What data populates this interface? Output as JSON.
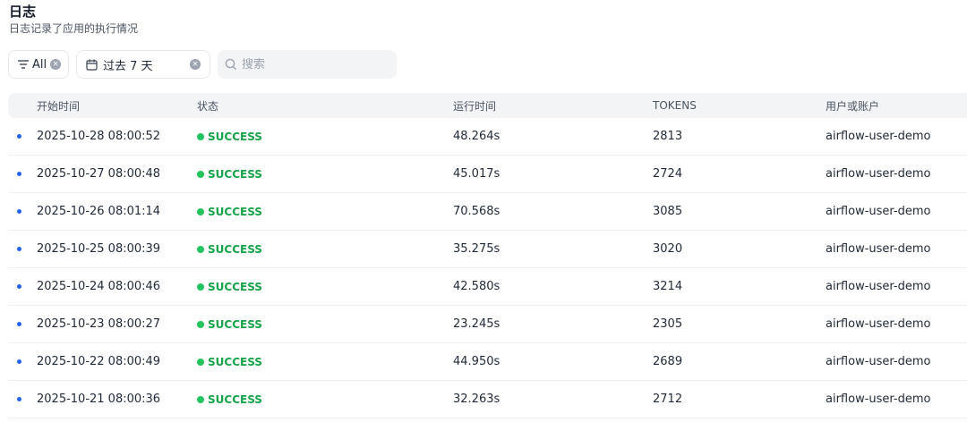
{
  "header": {
    "title": "日志",
    "subtitle": "日志记录了应用的执行情况"
  },
  "filters": {
    "status_label": "All",
    "date_label": "过去 7 天",
    "search_placeholder": "搜索"
  },
  "table": {
    "columns": [
      "开始时间",
      "状态",
      "运行时间",
      "TOKENS",
      "用户或账户"
    ],
    "rows": [
      {
        "start": "2025-10-28 08:00:52",
        "status": "SUCCESS",
        "duration": "48.264s",
        "tokens": "2813",
        "user": "airflow-user-demo"
      },
      {
        "start": "2025-10-27 08:00:48",
        "status": "SUCCESS",
        "duration": "45.017s",
        "tokens": "2724",
        "user": "airflow-user-demo"
      },
      {
        "start": "2025-10-26 08:01:14",
        "status": "SUCCESS",
        "duration": "70.568s",
        "tokens": "3085",
        "user": "airflow-user-demo"
      },
      {
        "start": "2025-10-25 08:00:39",
        "status": "SUCCESS",
        "duration": "35.275s",
        "tokens": "3020",
        "user": "airflow-user-demo"
      },
      {
        "start": "2025-10-24 08:00:46",
        "status": "SUCCESS",
        "duration": "42.580s",
        "tokens": "3214",
        "user": "airflow-user-demo"
      },
      {
        "start": "2025-10-23 08:00:27",
        "status": "SUCCESS",
        "duration": "23.245s",
        "tokens": "2305",
        "user": "airflow-user-demo"
      },
      {
        "start": "2025-10-22 08:00:49",
        "status": "SUCCESS",
        "duration": "44.950s",
        "tokens": "2689",
        "user": "airflow-user-demo"
      },
      {
        "start": "2025-10-21 08:00:36",
        "status": "SUCCESS",
        "duration": "32.263s",
        "tokens": "2712",
        "user": "airflow-user-demo"
      }
    ]
  },
  "colors": {
    "accent": "#2563eb",
    "success": "#16a34a",
    "success_dot": "#22c55e",
    "header_bg": "#f3f4f6"
  },
  "icons": {
    "filter": "filter-icon",
    "calendar": "calendar-icon",
    "clear": "clear-icon",
    "search": "search-icon"
  }
}
